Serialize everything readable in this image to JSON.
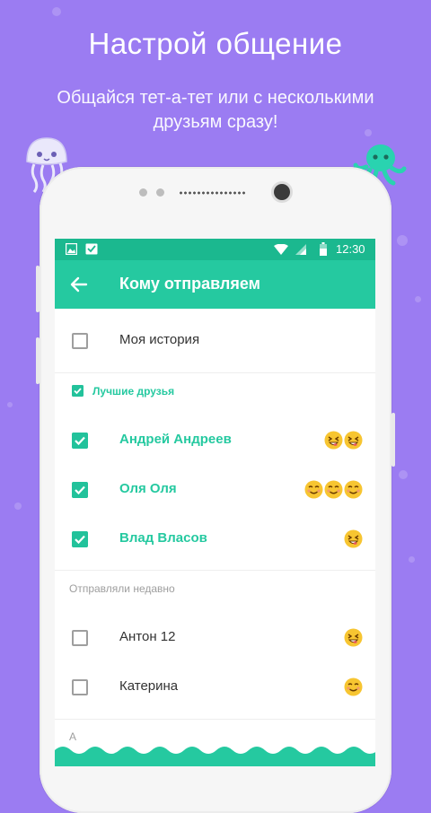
{
  "promo": {
    "title": "Настрой общение",
    "subtitle_line1": "Общайся тет-а-тет или с несколькими",
    "subtitle_line2": "друзьям сразу!"
  },
  "status_bar": {
    "time": "12:30"
  },
  "app_bar": {
    "title": "Кому отправляем"
  },
  "my_story": {
    "label": "Моя история",
    "checked": false
  },
  "best_friends": {
    "header": "Лучшие друзья",
    "items": [
      {
        "name": "Андрей Андреев",
        "checked": true,
        "emojis": [
          "grin-squint",
          "grin-squint"
        ]
      },
      {
        "name": "Оля Оля",
        "checked": true,
        "emojis": [
          "smile",
          "smile",
          "smile"
        ]
      },
      {
        "name": "Влад Власов",
        "checked": true,
        "emojis": [
          "grin-squint"
        ]
      }
    ]
  },
  "recent": {
    "header": "Отправляли недавно",
    "items": [
      {
        "name": "Антон 12",
        "checked": false,
        "emojis": [
          "grin-squint"
        ]
      },
      {
        "name": "Катерина",
        "checked": false,
        "emojis": [
          "smile"
        ]
      }
    ]
  },
  "alpha_header": "А",
  "colors": {
    "background": "#9b7cf2",
    "accent": "#25c9a0",
    "status_bar": "#1bb88f"
  }
}
